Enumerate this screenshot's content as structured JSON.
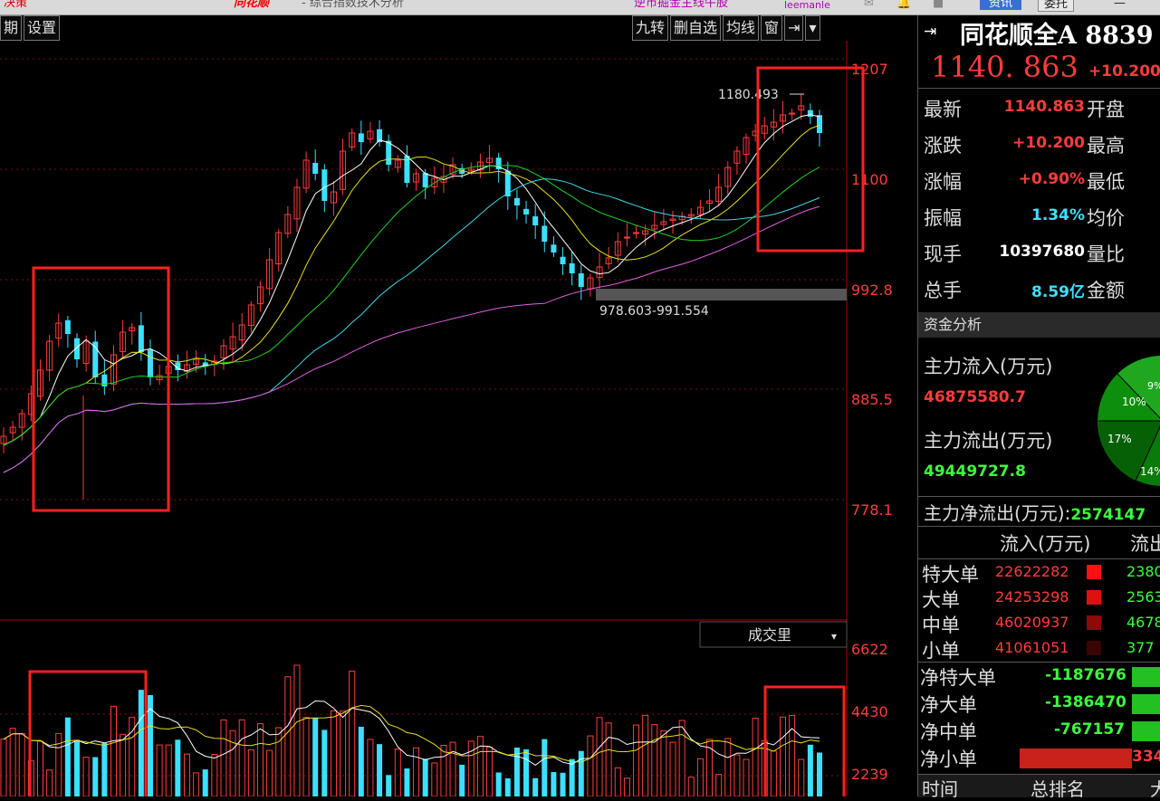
{
  "titlebar": {
    "left": "决策",
    "logo": "同花顺",
    "title": "- 综合指数技术分析",
    "center": "逆市掘金主线牛股",
    "user": "leemanle",
    "btn_news": "资讯",
    "btn_trade": "委托"
  },
  "toolbar": {
    "left": [
      "期",
      "设置"
    ],
    "right": [
      "九转",
      "删自选",
      "均线",
      "窗",
      "⇥",
      "▾"
    ]
  },
  "price_chart": {
    "y_ticks": [
      "1207",
      "1100",
      "992.8",
      "885.5",
      "778.1"
    ],
    "high_annotation": "1180.493",
    "gap_annotation": "978.603-991.554"
  },
  "volume_chart": {
    "label": "成交里",
    "y_ticks": [
      "6622",
      "4430",
      "2239"
    ]
  },
  "quote": {
    "title": "同花顺全A 8839",
    "price": "1140. 863",
    "change": "+10.200",
    "rows": [
      {
        "label": "最新",
        "value": "1140.863",
        "color": "red",
        "label2": "开盘"
      },
      {
        "label": "涨跌",
        "value": "+10.200",
        "color": "red",
        "label2": "最高"
      },
      {
        "label": "涨幅",
        "value": "+0.90%",
        "color": "red",
        "label2": "最低"
      },
      {
        "label": "振幅",
        "value": "1.34%",
        "color": "cyan",
        "label2": "均价"
      },
      {
        "label": "现手",
        "value": "10397680",
        "color": "white",
        "label2": "量比"
      },
      {
        "label": "总手",
        "value": "8.59亿",
        "color": "cyan",
        "label2": "金额"
      }
    ]
  },
  "fund": {
    "section": "资金分析",
    "inflow_label": "主力流入(万元)",
    "inflow_value": "46875580.7",
    "outflow_label": "主力流出(万元)",
    "outflow_value": "49449727.8",
    "net_label": "主力净流出(万元):",
    "net_value": "2574147",
    "pie_labels": [
      "9%",
      "10%",
      "17%",
      "14%"
    ],
    "col_in": "流入(万元)",
    "col_out": "流出",
    "orders": [
      {
        "name": "特大单",
        "in": "22622282",
        "out": "2380"
      },
      {
        "name": "大单",
        "in": "24253298",
        "out": "2563"
      },
      {
        "name": "中单",
        "in": "46020937",
        "out": "4678"
      },
      {
        "name": "小单",
        "in": "41061051",
        "out": "377"
      }
    ],
    "net": [
      {
        "name": "净特大单",
        "value": "-1187676"
      },
      {
        "name": "净大单",
        "value": "-1386470"
      },
      {
        "name": "净中单",
        "value": "-767157"
      },
      {
        "name": "净小单",
        "value": "334"
      }
    ],
    "footer_time": "时间",
    "footer_rank": "总排名",
    "footer_more": "大"
  },
  "colors": {
    "up": "#ff3c3c",
    "down": "#3ce0ff",
    "highlight": "#ff2020"
  }
}
